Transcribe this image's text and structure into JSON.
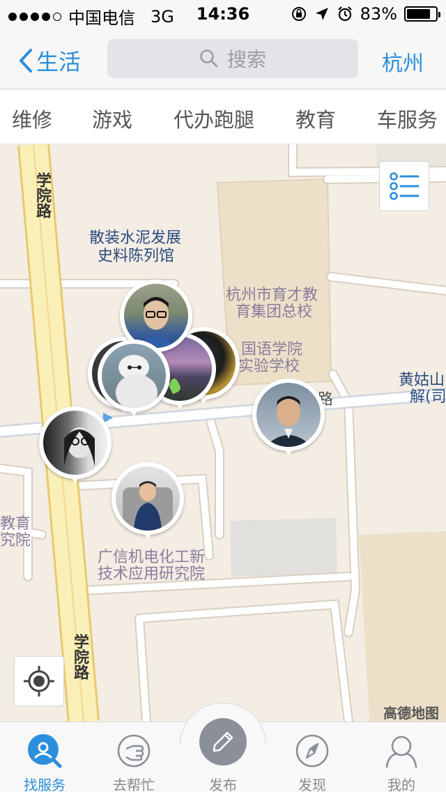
{
  "status_bar": {
    "carrier": "中国电信",
    "network": "3G",
    "time": "14:36",
    "battery": "83%",
    "battery_level": 0.83
  },
  "nav": {
    "back_label": "生活",
    "search_placeholder": "搜索",
    "city": "杭州"
  },
  "categories": [
    "维修",
    "游戏",
    "代办跑腿",
    "教育",
    "车服务"
  ],
  "map": {
    "roads": [
      "学院路",
      "学院路",
      "路"
    ],
    "places": [
      "散装水泥发展",
      "史料陈列馆",
      "杭州市育才教",
      "育集团总校",
      "国语学院",
      "实验学校",
      "黄姑山",
      "解(司",
      "广信机电化工新",
      "技术应用研究院",
      "教育",
      "究院"
    ],
    "brand": "高德地图",
    "list_icon": "list-icon",
    "locate_icon": "locate-icon"
  },
  "tabs": [
    {
      "label": "找服务",
      "icon": "find-service-icon"
    },
    {
      "label": "去帮忙",
      "icon": "help-hand-icon"
    },
    {
      "label": "发布",
      "icon": "pencil-icon"
    },
    {
      "label": "发现",
      "icon": "compass-icon"
    },
    {
      "label": "我的",
      "icon": "person-icon"
    }
  ],
  "colors": {
    "accent": "#2b8fdc",
    "map_bg": "#f3ede4",
    "road_major": "#fbefb8",
    "block": "#ece0c8"
  }
}
